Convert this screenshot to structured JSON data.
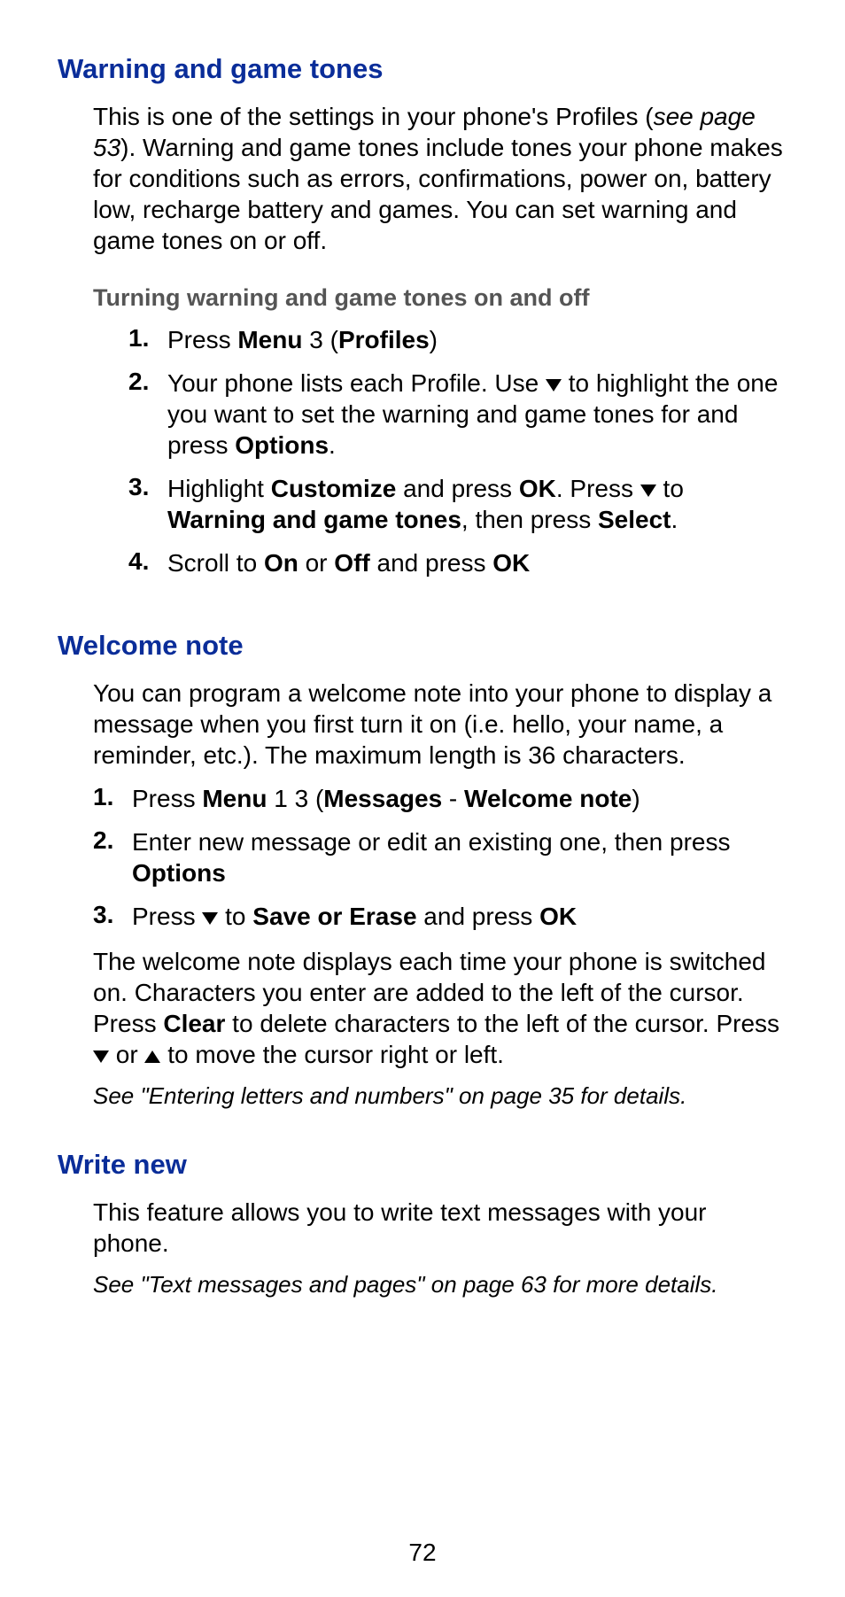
{
  "page_number": "72",
  "s1": {
    "heading": "Warning and game tones",
    "intro_a": "This is one of the settings in your phone's Profiles (",
    "intro_ref": "see page 53",
    "intro_b": "). Warning and game tones include tones your phone makes for conditions such as errors, confirmations, power on, battery low, recharge battery and games. You can set warning and game tones on or off.",
    "sub_heading": "Turning warning and game tones on and off",
    "steps": [
      {
        "n": "1.",
        "a": "Press ",
        "b1": "Menu",
        "b": " 3 (",
        "b2": "Profiles",
        "c": ")"
      },
      {
        "n": "2.",
        "a": "Your phone lists each Profile. Use ",
        "arrow": "down",
        "b": " to highlight the one you want to set the warning and game tones for and press ",
        "b1": "Options",
        "c": "."
      },
      {
        "n": "3.",
        "a": "Highlight ",
        "b1": "Customize",
        "b": " and press ",
        "b2": "OK",
        "c": ". Press ",
        "arrow": "down",
        "d": " to ",
        "b3": "Warning and game tones",
        "e": ", then press ",
        "b4": "Select",
        "f": "."
      },
      {
        "n": "4.",
        "a": "Scroll to ",
        "b1": "On",
        "b": " or ",
        "b2": "Off",
        "c": " and press ",
        "b3": "OK"
      }
    ]
  },
  "s2": {
    "heading": "Welcome note",
    "intro": "You can program a welcome note into your phone to display a message when you first turn it on (i.e. hello, your name, a reminder, etc.). The maximum length is 36 characters.",
    "steps": [
      {
        "n": "1.",
        "a": "Press ",
        "b1": "Menu",
        "b": " 1 3 (",
        "b2": "Messages",
        "c": " - ",
        "b3": "Welcome note",
        "d": ")"
      },
      {
        "n": "2.",
        "a": "Enter new message or edit an existing one, then press ",
        "b1": "Options"
      },
      {
        "n": "3.",
        "a": "Press ",
        "arrow": "down",
        "b": " to ",
        "b1": "Save or Erase",
        "c": " and press ",
        "b2": "OK"
      }
    ],
    "after_a": "The welcome note displays each time your phone is switched on. Characters you enter are added to the left of the cursor. Press ",
    "after_b1": "Clear",
    "after_b": " to delete characters to the left of the cursor. Press ",
    "after_c": " or ",
    "after_d": " to move the cursor right or left.",
    "ref": "See \"Entering letters and numbers\" on page 35 for details."
  },
  "s3": {
    "heading": "Write new",
    "intro": "This feature allows you to write text messages with your phone.",
    "ref": "See \"Text messages and pages\" on page 63 for more details."
  }
}
